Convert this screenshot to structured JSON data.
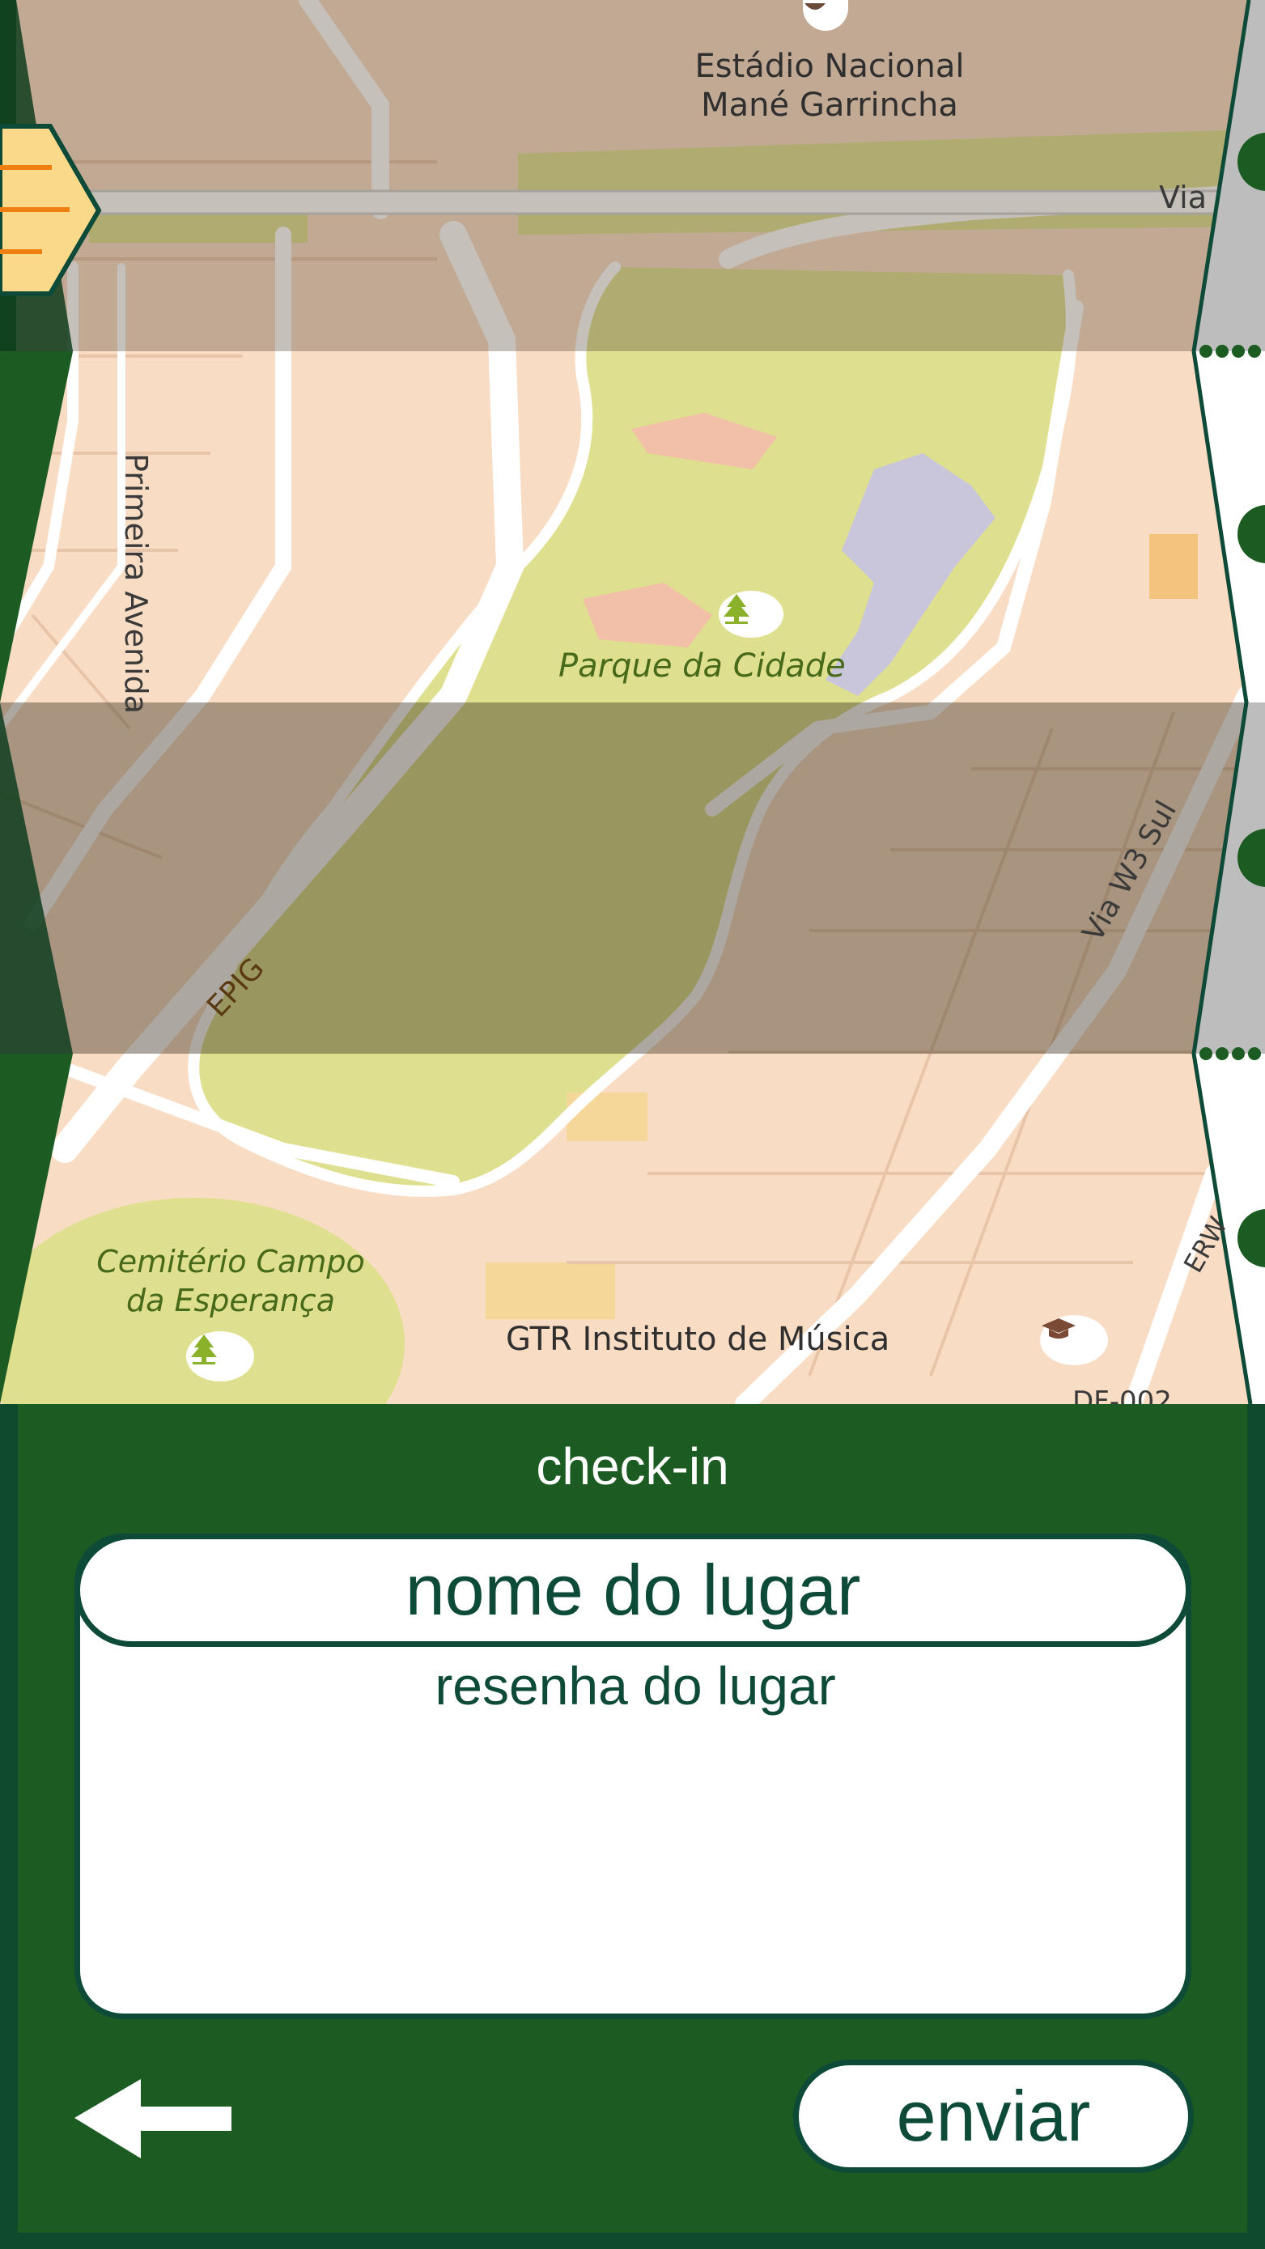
{
  "map": {
    "labels": {
      "stadium_line1": "Estádio Nacional",
      "stadium_line2": "Mané Garrincha",
      "park": "Parque da Cidade",
      "cemetery_line1": "Cemitério Campo",
      "cemetery_line2": "da Esperança",
      "music_school": "GTR Instituto de Música",
      "road_primeira": "Primeira Avenida",
      "road_epig": "EPIG",
      "road_w3": "Via W3 Sul",
      "road_via": "Via",
      "road_erw": "ERW",
      "road_df": "DF-002"
    },
    "icons": {
      "park_poi": "tree-icon",
      "cemetery_poi": "tree-icon",
      "music_poi": "graduation-cap-icon",
      "stadium_poi": "stadium-icon",
      "menu": "hamburger-menu-icon"
    }
  },
  "checkin": {
    "title": "check-in",
    "name_placeholder": "nome do lugar",
    "review_placeholder": "resenha do lugar",
    "send_label": "enviar",
    "back_icon": "arrow-left-icon"
  },
  "colors": {
    "panel_green": "#1c5c22",
    "dark_teal": "#0d4a38",
    "menu_yellow": "#fbd98a",
    "menu_orange": "#f07f12"
  }
}
